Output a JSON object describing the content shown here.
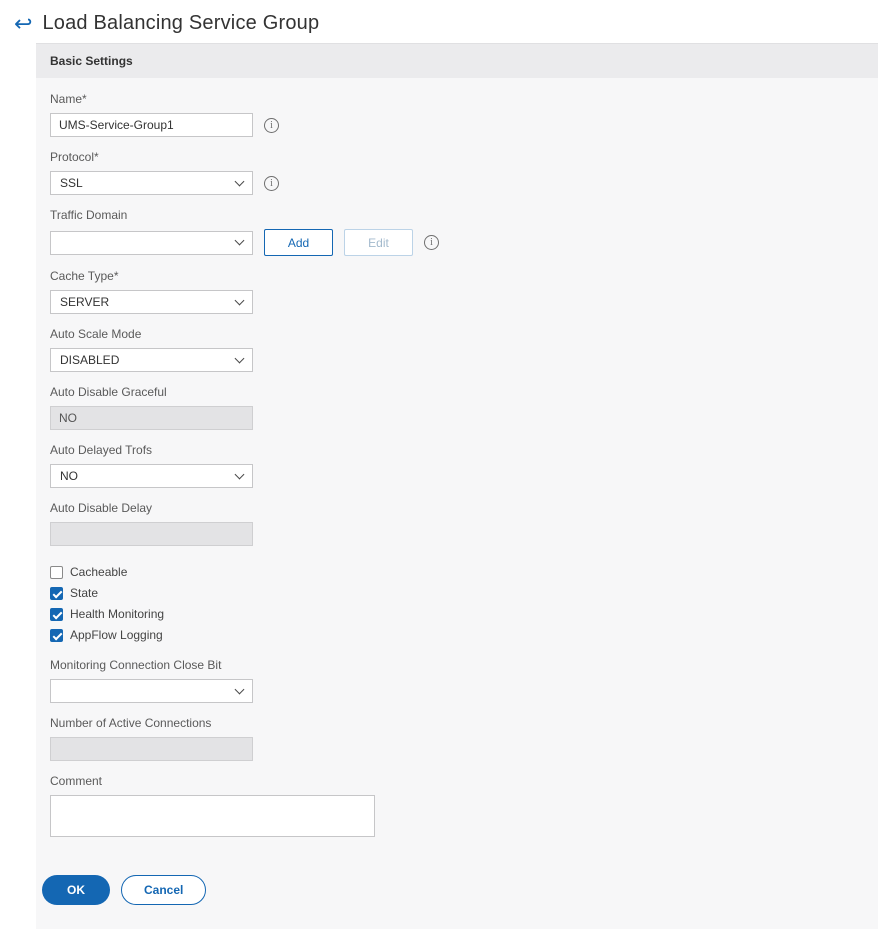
{
  "page": {
    "title": "Load Balancing Service Group"
  },
  "icons": {
    "back": "↩",
    "info": "i"
  },
  "panel": {
    "header": "Basic Settings"
  },
  "fields": {
    "name": {
      "label": "Name*",
      "value": "UMS-Service-Group1"
    },
    "protocol": {
      "label": "Protocol*",
      "value": "SSL"
    },
    "traffic_domain": {
      "label": "Traffic Domain",
      "value": "",
      "add_label": "Add",
      "edit_label": "Edit"
    },
    "cache_type": {
      "label": "Cache Type*",
      "value": "SERVER"
    },
    "auto_scale_mode": {
      "label": "Auto Scale Mode",
      "value": "DISABLED"
    },
    "auto_disable_graceful": {
      "label": "Auto Disable Graceful",
      "value": "NO"
    },
    "auto_delayed_trofs": {
      "label": "Auto Delayed Trofs",
      "value": "NO"
    },
    "auto_disable_delay": {
      "label": "Auto Disable Delay",
      "value": ""
    },
    "checkboxes": [
      {
        "label": "Cacheable",
        "checked": false
      },
      {
        "label": "State",
        "checked": true
      },
      {
        "label": "Health Monitoring",
        "checked": true
      },
      {
        "label": "AppFlow Logging",
        "checked": true
      }
    ],
    "monitoring_connection_close_bit": {
      "label": "Monitoring Connection Close Bit",
      "value": ""
    },
    "number_of_active_connections": {
      "label": "Number of Active Connections",
      "value": ""
    },
    "comment": {
      "label": "Comment",
      "value": ""
    }
  },
  "footer": {
    "ok_label": "OK",
    "cancel_label": "Cancel"
  },
  "colors": {
    "primary_blue": "#1467b3",
    "panel_bg": "#f7f7f8",
    "panel_header_bg": "#ebebed",
    "disabled_input_bg": "#e3e3e5"
  }
}
